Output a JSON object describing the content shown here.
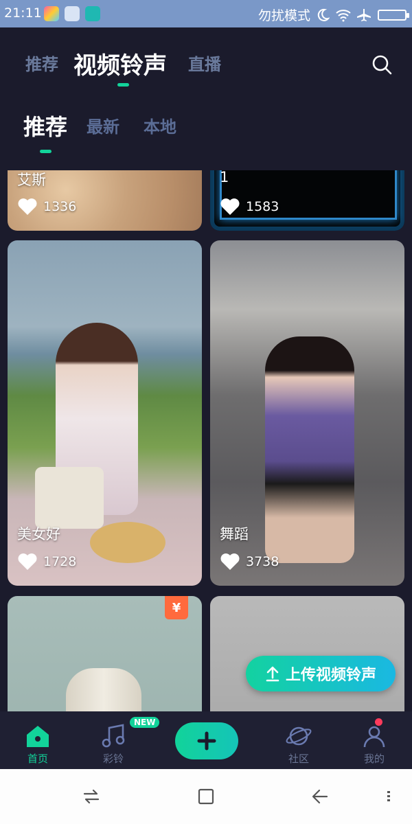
{
  "status_bar": {
    "time": "21:11",
    "right_text": "勿扰模式",
    "icons": [
      "moon-icon",
      "wifi-icon",
      "airplane-icon",
      "battery-icon"
    ]
  },
  "top_tabs": [
    {
      "label": "推荐",
      "active": false
    },
    {
      "label": "视频铃声",
      "active": true
    },
    {
      "label": "直播",
      "active": false
    }
  ],
  "sub_tabs": [
    {
      "label": "推荐",
      "active": true
    },
    {
      "label": "最新",
      "active": false
    },
    {
      "label": "本地",
      "active": false
    }
  ],
  "cards": [
    {
      "title": "艾斯",
      "likes": "1336"
    },
    {
      "title": "1",
      "likes": "1583"
    },
    {
      "title": "美女好",
      "likes": "1728"
    },
    {
      "title": "舞蹈",
      "likes": "3738"
    },
    {
      "title": "",
      "likes": "",
      "badge": "¥"
    },
    {
      "title": "",
      "likes": ""
    }
  ],
  "upload_button": {
    "label": "上传视频铃声"
  },
  "bottom_nav": {
    "items": [
      {
        "label": "首页",
        "icon": "home-icon",
        "active": true
      },
      {
        "label": "彩铃",
        "icon": "music-note-icon",
        "badge": "NEW"
      },
      {
        "label": "",
        "icon": "plus-icon"
      },
      {
        "label": "社区",
        "icon": "planet-icon"
      },
      {
        "label": "我的",
        "icon": "user-icon"
      }
    ]
  },
  "colors": {
    "accent": "#12d39a",
    "background": "#1b1b2c",
    "inactive_tab": "#6a7a9c"
  }
}
